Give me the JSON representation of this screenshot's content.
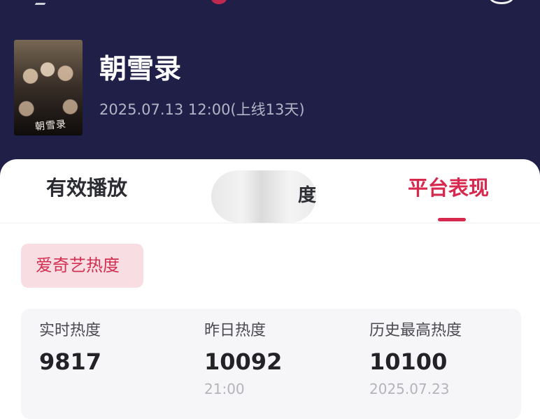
{
  "header": {
    "title": "朝雪录",
    "release_info": "2025.07.13 12:00(上线13天)"
  },
  "poster": {
    "title_text": "朝雪录"
  },
  "tabs": [
    {
      "label": "有效播放",
      "active": false
    },
    {
      "label": "度",
      "active": false
    },
    {
      "label": "平台表现",
      "active": true
    }
  ],
  "badge": {
    "label": "爱奇艺热度"
  },
  "stats": [
    {
      "label": "实时热度",
      "value": "9817",
      "sub": ""
    },
    {
      "label": "昨日热度",
      "value": "10092",
      "sub": "21:00"
    },
    {
      "label": "历史最高热度",
      "value": "10100",
      "sub": "2025.07.23"
    }
  ],
  "colors": {
    "header_bg": "#1f1f47",
    "accent": "#d7284d",
    "badge_bg": "#f8dde3",
    "card_bg": "#f6f6f8"
  }
}
